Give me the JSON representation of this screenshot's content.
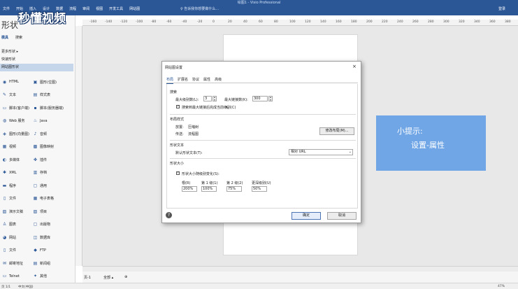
{
  "ribbon": {
    "title": "绘图1 - Visio Professional",
    "menu": [
      "文件",
      "开始",
      "插入",
      "设计",
      "数据",
      "流程",
      "审阅",
      "视图",
      "开发工具",
      "网站图"
    ],
    "search_placeholder": "告诉我你想要做什么...",
    "login": "登录"
  },
  "sidebar": {
    "heading": "形状",
    "tabs": [
      "模具",
      "搜索"
    ],
    "links": [
      "更多形状 ▸",
      "快速形状",
      "网站图形状"
    ],
    "shapes": [
      {
        "icon": "html-icon",
        "label": "HTML",
        "col": 0
      },
      {
        "icon": "image-icon",
        "label": "图形(位图)",
        "col": 1
      },
      {
        "icon": "text-icon",
        "label": "文本",
        "col": 0
      },
      {
        "icon": "form-icon",
        "label": "样式表",
        "col": 1
      },
      {
        "icon": "script-client-icon",
        "label": "脚本(客户端)",
        "col": 0
      },
      {
        "icon": "script-server-icon",
        "label": "脚本(服务器端)",
        "col": 1
      },
      {
        "icon": "web-service-icon",
        "label": "Web 服务",
        "col": 0
      },
      {
        "icon": "java-icon",
        "label": "Java",
        "col": 1
      },
      {
        "icon": "vector-icon",
        "label": "图形(向量图)",
        "col": 0
      },
      {
        "icon": "audio-icon",
        "label": "音频",
        "col": 1
      },
      {
        "icon": "video-icon",
        "label": "视频",
        "col": 0
      },
      {
        "icon": "image-map-icon",
        "label": "图像映射",
        "col": 1
      },
      {
        "icon": "multimedia-icon",
        "label": "多媒体",
        "col": 0
      },
      {
        "icon": "plugin-icon",
        "label": "插件",
        "col": 1
      },
      {
        "icon": "xml-icon",
        "label": "XML",
        "col": 0
      },
      {
        "icon": "archive-icon",
        "label": "存档",
        "col": 1
      },
      {
        "icon": "program-icon",
        "label": "程序",
        "col": 0
      },
      {
        "icon": "general-icon",
        "label": "通用",
        "col": 1
      },
      {
        "icon": "file-icon",
        "label": "文件",
        "col": 0
      },
      {
        "icon": "spreadsheet-icon",
        "label": "电子表格",
        "col": 1
      },
      {
        "icon": "presentation-icon",
        "label": "演示文稿",
        "col": 0
      },
      {
        "icon": "project-icon",
        "label": "项目",
        "col": 1
      },
      {
        "icon": "drawing-icon",
        "label": "图表",
        "col": 0
      },
      {
        "icon": "publication-icon",
        "label": "出版物",
        "col": 1
      },
      {
        "icon": "website-icon",
        "label": "网站",
        "col": 0
      },
      {
        "icon": "database-icon",
        "label": "数据库",
        "col": 1
      },
      {
        "icon": "doc-icon",
        "label": "文件",
        "col": 0
      },
      {
        "icon": "ftp-icon",
        "label": "FTP",
        "col": 1
      },
      {
        "icon": "mail-icon",
        "label": "邮寄地址",
        "col": 0
      },
      {
        "icon": "newsgroup-icon",
        "label": "新闻组",
        "col": 1
      },
      {
        "icon": "telnet-icon",
        "label": "Telnet",
        "col": 0
      },
      {
        "icon": "gopher-icon",
        "label": "其他",
        "col": 1
      }
    ]
  },
  "watermark": "秒懂视频",
  "ruler": [
    "-160",
    "-140",
    "-120",
    "-100",
    "-80",
    "-60",
    "-40",
    "-20",
    "0",
    "20",
    "40",
    "60",
    "80",
    "100",
    "120",
    "140",
    "160",
    "180",
    "200",
    "220",
    "240",
    "260",
    "280",
    "300",
    "320",
    "340",
    "360",
    "380"
  ],
  "dialog": {
    "title": "网站图设置",
    "tabs": [
      "布局",
      "扩展名",
      "协议",
      "属性",
      "高级"
    ],
    "search_section": "搜索",
    "max_levels_label": "最大级别数(L):",
    "max_levels_value": "3",
    "max_links_label": "最大链接数(K):",
    "max_links_value": "300",
    "complete_level_label": "搜索到最大链接后完成当前级别(C)",
    "layout_section": "布局样式",
    "arrange_label": "放置:",
    "arrange_value": "压缩树",
    "route_label": "传送:",
    "route_value": "流程图",
    "modify_layout_button": "修改布局(M)...",
    "shape_text_section": "形状文本",
    "default_text_label": "默认形状文本(T):",
    "default_text_value": "相对 URL",
    "shape_size_section": "形状大小",
    "size_vary_label": "形状大小随级别变化(S):",
    "levels": [
      {
        "label": "根(R)",
        "value": "200%"
      },
      {
        "label": "第 1 级(1)",
        "value": "100%"
      },
      {
        "label": "第 2 级(2)",
        "value": "75%"
      },
      {
        "label": "更深级别(U)",
        "value": "50%"
      }
    ],
    "ok_button": "确定",
    "cancel_button": "取消"
  },
  "tip": {
    "line1": "小提示:",
    "line2": "设置-属性"
  },
  "page_tabs": {
    "page": "页-1",
    "all": "全部 ▴",
    "add": "⊕"
  },
  "status": {
    "page_info": "页 1/1",
    "language": "中文(中国)",
    "zoom": "47%"
  },
  "colors": {
    "ribbon": "#2b5797",
    "tip": "#70a6e6",
    "selected": "#c5d5ea"
  }
}
